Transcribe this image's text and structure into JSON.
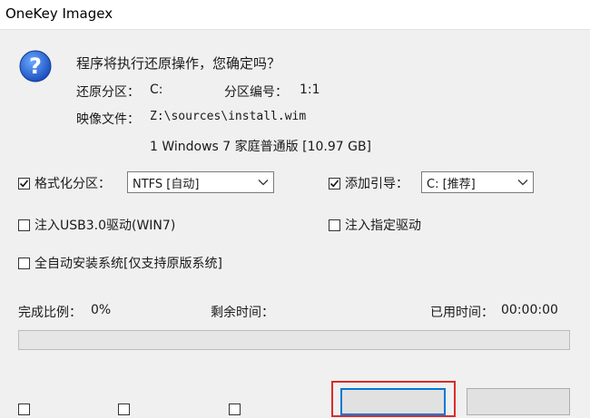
{
  "window": {
    "title": "OneKey Imagex"
  },
  "message": {
    "question": "程序将执行还原操作，您确定吗？"
  },
  "info": {
    "restore_partition_label": "还原分区：",
    "restore_partition_value": "C:",
    "partition_number_label": "分区编号：",
    "partition_number_value": "1:1",
    "image_file_label": "映像文件：",
    "image_file_value": "Z:\\sources\\install.wim",
    "image_entry": "1 Windows 7 家庭普通版 [10.97 GB]"
  },
  "options": {
    "format_partition": {
      "label": "格式化分区：",
      "checked": true
    },
    "filesystem_select": {
      "value": "NTFS [自动]"
    },
    "add_boot": {
      "label": "添加引导：",
      "checked": true
    },
    "boot_select": {
      "value": "C: [推荐]"
    },
    "inject_usb3": {
      "label": "注入USB3.0驱动(WIN7)",
      "checked": false
    },
    "inject_driver": {
      "label": "注入指定驱动",
      "checked": false
    },
    "auto_install": {
      "label": "全自动安装系统[仅支持原版系统]",
      "checked": false
    }
  },
  "progress": {
    "completion_label": "完成比例：",
    "completion_value": "0%",
    "remaining_label": "剩余时间：",
    "remaining_value": "",
    "elapsed_label": "已用时间：",
    "elapsed_value": "00:00:00",
    "fraction": 0
  },
  "colors": {
    "accent": "#0078d7",
    "progress_fill": "#06b025",
    "highlight": "#d92b2b"
  },
  "icons": {
    "question": "question-mark-icon",
    "check": "checkmark-icon",
    "dropdown": "chevron-down-icon"
  }
}
